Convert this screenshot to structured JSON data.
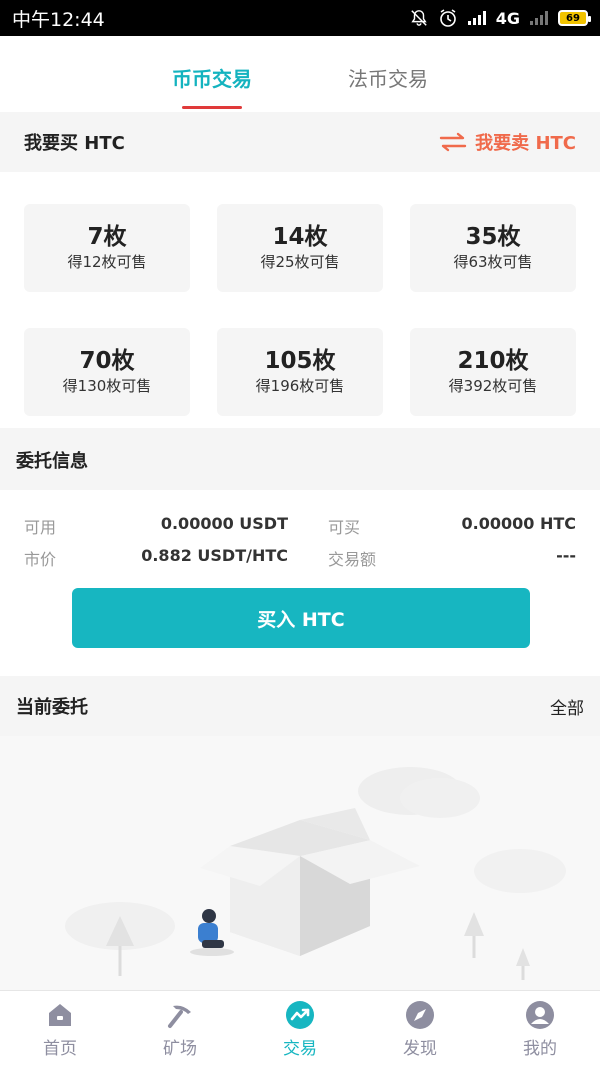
{
  "status_bar": {
    "time": "中午12:44",
    "network": "4G",
    "battery": "69"
  },
  "tabs": [
    {
      "label": "币币交易",
      "active": true
    },
    {
      "label": "法币交易",
      "active": false
    }
  ],
  "buy_header": {
    "title": "我要买 HTC",
    "switch_label": "我要卖 HTC"
  },
  "packages": [
    {
      "amount": "7枚",
      "note": "得12枚可售"
    },
    {
      "amount": "14枚",
      "note": "得25枚可售"
    },
    {
      "amount": "35枚",
      "note": "得63枚可售"
    },
    {
      "amount": "70枚",
      "note": "得130枚可售"
    },
    {
      "amount": "105枚",
      "note": "得196枚可售"
    },
    {
      "amount": "210枚",
      "note": "得392枚可售"
    }
  ],
  "entrust_info": {
    "title": "委托信息",
    "available_label": "可用",
    "available_value": "0.00000 USDT",
    "buyable_label": "可买",
    "buyable_value": "0.00000 HTC",
    "price_label": "市价",
    "price_value": "0.882 USDT/HTC",
    "amount_label": "交易额",
    "amount_value": "---",
    "buy_button": "买入 HTC"
  },
  "current_orders": {
    "title": "当前委托",
    "all_label": "全部"
  },
  "bottom_nav": [
    {
      "label": "首页",
      "icon": "home-icon",
      "active": false
    },
    {
      "label": "矿场",
      "icon": "pickaxe-icon",
      "active": false
    },
    {
      "label": "交易",
      "icon": "trade-icon",
      "active": true
    },
    {
      "label": "发现",
      "icon": "compass-icon",
      "active": false
    },
    {
      "label": "我的",
      "icon": "profile-icon",
      "active": false
    }
  ],
  "colors": {
    "accent": "#17b6c1",
    "sell": "#f06a4b",
    "tab_underline": "#e03a3a"
  }
}
